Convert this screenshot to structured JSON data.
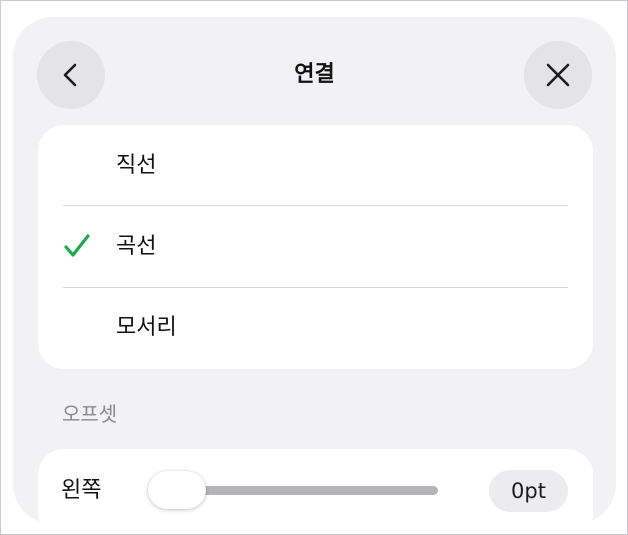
{
  "header": {
    "title": "연결",
    "back_icon": "chevron-left-icon",
    "close_icon": "close-icon"
  },
  "connection_options": [
    {
      "label": "직선",
      "selected": false
    },
    {
      "label": "곡선",
      "selected": true
    },
    {
      "label": "모서리",
      "selected": false
    }
  ],
  "colors": {
    "check": "#1fa84f",
    "sheet_bg": "#f2f2f4",
    "card_bg": "#ffffff"
  },
  "offset": {
    "section_title": "오프셋",
    "label": "왼쪽",
    "value_text": "0pt",
    "slider_fraction": 0
  }
}
